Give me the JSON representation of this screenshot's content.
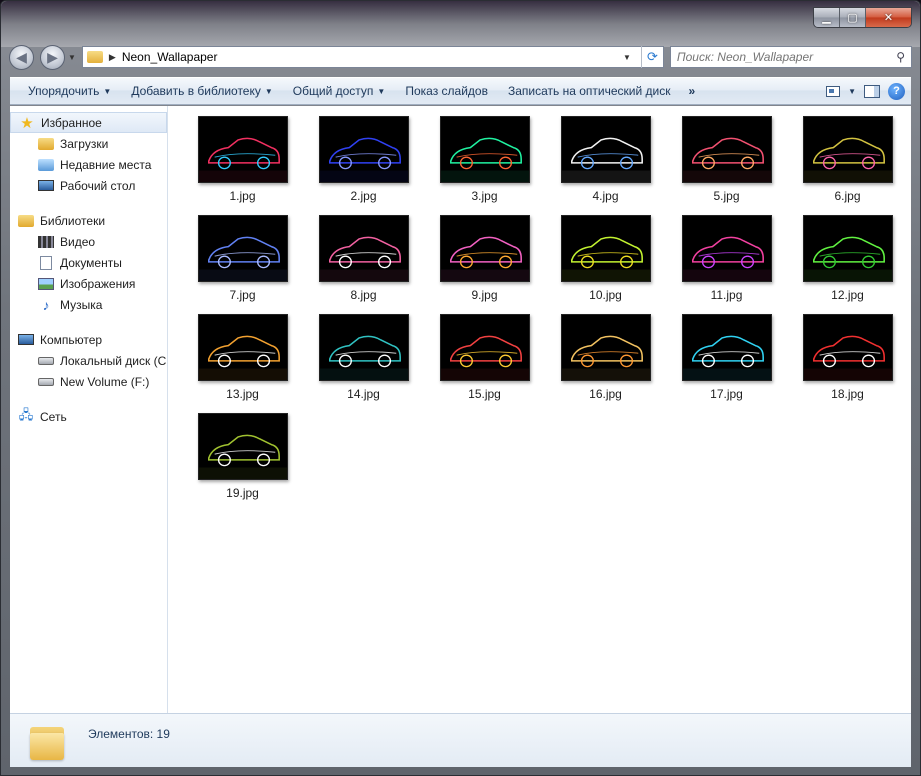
{
  "window": {
    "caption_minimize": "▁",
    "caption_maximize": "▢",
    "caption_close": "✕"
  },
  "nav": {
    "back_icon": "back-arrow-icon",
    "forward_icon": "forward-arrow-icon",
    "path_folder": "Neon_Wallapaper",
    "search_placeholder": "Поиск: Neon_Wallapaper"
  },
  "toolbar": {
    "organize": "Упорядочить",
    "add_to_library": "Добавить в библиотеку",
    "share": "Общий доступ",
    "slideshow": "Показ слайдов",
    "burn": "Записать на оптический диск",
    "more": "»",
    "help": "?"
  },
  "sidebar": {
    "favorites": {
      "header": "Избранное",
      "items": [
        "Загрузки",
        "Недавние места",
        "Рабочий стол"
      ]
    },
    "libraries": {
      "header": "Библиотеки",
      "items": [
        "Видео",
        "Документы",
        "Изображения",
        "Музыка"
      ]
    },
    "computer": {
      "header": "Компьютер",
      "items": [
        "Локальный диск (C:)",
        "New Volume (F:)"
      ]
    },
    "network": {
      "header": "Сеть"
    }
  },
  "files": [
    {
      "name": "1.jpg",
      "colors": [
        "#ff3366",
        "#33ccff"
      ]
    },
    {
      "name": "2.jpg",
      "colors": [
        "#3344ff",
        "#8899ff"
      ]
    },
    {
      "name": "3.jpg",
      "colors": [
        "#22ffaa",
        "#ff6633"
      ]
    },
    {
      "name": "4.jpg",
      "colors": [
        "#ffffff",
        "#66aaff"
      ]
    },
    {
      "name": "5.jpg",
      "colors": [
        "#ff5577",
        "#ffaa66"
      ]
    },
    {
      "name": "6.jpg",
      "colors": [
        "#ddcc44",
        "#ff66aa"
      ]
    },
    {
      "name": "7.jpg",
      "colors": [
        "#6688ff",
        "#aabbff"
      ]
    },
    {
      "name": "8.jpg",
      "colors": [
        "#ff66aa",
        "#ffffff"
      ]
    },
    {
      "name": "9.jpg",
      "colors": [
        "#ff66cc",
        "#ffaa33"
      ]
    },
    {
      "name": "10.jpg",
      "colors": [
        "#ccff33",
        "#eedd22"
      ]
    },
    {
      "name": "11.jpg",
      "colors": [
        "#ff44aa",
        "#cc44ff"
      ]
    },
    {
      "name": "12.jpg",
      "colors": [
        "#66ff44",
        "#33cc33"
      ]
    },
    {
      "name": "13.jpg",
      "colors": [
        "#ffaa33",
        "#ffffff"
      ]
    },
    {
      "name": "14.jpg",
      "colors": [
        "#33cccc",
        "#ffffff"
      ]
    },
    {
      "name": "15.jpg",
      "colors": [
        "#ff4444",
        "#ffcc33"
      ]
    },
    {
      "name": "16.jpg",
      "colors": [
        "#ffcc66",
        "#ff9933"
      ]
    },
    {
      "name": "17.jpg",
      "colors": [
        "#33ddff",
        "#ffffff"
      ]
    },
    {
      "name": "18.jpg",
      "colors": [
        "#ff3333",
        "#ffffff"
      ]
    },
    {
      "name": "19.jpg",
      "colors": [
        "#aacc33",
        "#ffffff"
      ]
    }
  ],
  "status": {
    "count": "Элементов: 19"
  }
}
